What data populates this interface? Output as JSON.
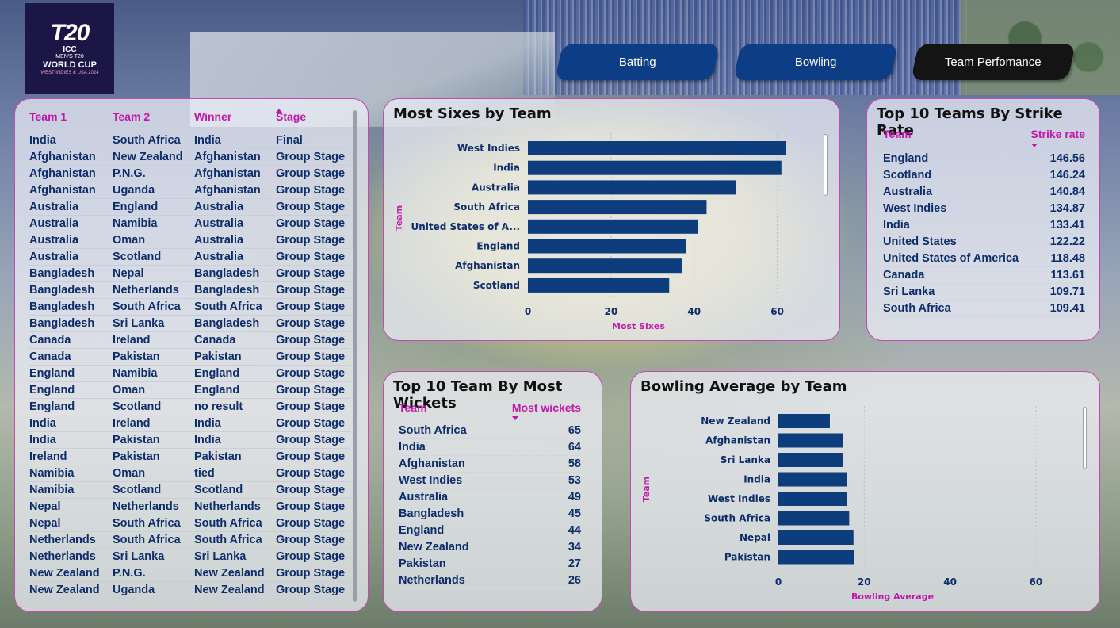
{
  "logo": {
    "mark_text": "T20",
    "line1": "ICC",
    "line2": "MEN'S T20",
    "line3": "WORLD CUP",
    "line4": "WEST INDIES & USA 2024"
  },
  "nav": {
    "batting": "Batting",
    "bowling": "Bowling",
    "team_performance": "Team Perfomance"
  },
  "matches": {
    "headers": [
      "Team 1",
      "Team 2",
      "Winner",
      "Stage"
    ],
    "rows": [
      [
        "India",
        "South Africa",
        "India",
        "Final"
      ],
      [
        "Afghanistan",
        "New Zealand",
        "Afghanistan",
        "Group Stage"
      ],
      [
        "Afghanistan",
        "P.N.G.",
        "Afghanistan",
        "Group Stage"
      ],
      [
        "Afghanistan",
        "Uganda",
        "Afghanistan",
        "Group Stage"
      ],
      [
        "Australia",
        "England",
        "Australia",
        "Group Stage"
      ],
      [
        "Australia",
        "Namibia",
        "Australia",
        "Group Stage"
      ],
      [
        "Australia",
        "Oman",
        "Australia",
        "Group Stage"
      ],
      [
        "Australia",
        "Scotland",
        "Australia",
        "Group Stage"
      ],
      [
        "Bangladesh",
        "Nepal",
        "Bangladesh",
        "Group Stage"
      ],
      [
        "Bangladesh",
        "Netherlands",
        "Bangladesh",
        "Group Stage"
      ],
      [
        "Bangladesh",
        "South Africa",
        "South Africa",
        "Group Stage"
      ],
      [
        "Bangladesh",
        "Sri Lanka",
        "Bangladesh",
        "Group Stage"
      ],
      [
        "Canada",
        "Ireland",
        "Canada",
        "Group Stage"
      ],
      [
        "Canada",
        "Pakistan",
        "Pakistan",
        "Group Stage"
      ],
      [
        "England",
        "Namibia",
        "England",
        "Group Stage"
      ],
      [
        "England",
        "Oman",
        "England",
        "Group Stage"
      ],
      [
        "England",
        "Scotland",
        "no result",
        "Group Stage"
      ],
      [
        "India",
        "Ireland",
        "India",
        "Group Stage"
      ],
      [
        "India",
        "Pakistan",
        "India",
        "Group Stage"
      ],
      [
        "Ireland",
        "Pakistan",
        "Pakistan",
        "Group Stage"
      ],
      [
        "Namibia",
        "Oman",
        "tied",
        "Group Stage"
      ],
      [
        "Namibia",
        "Scotland",
        "Scotland",
        "Group Stage"
      ],
      [
        "Nepal",
        "Netherlands",
        "Netherlands",
        "Group Stage"
      ],
      [
        "Nepal",
        "South Africa",
        "South Africa",
        "Group Stage"
      ],
      [
        "Netherlands",
        "South Africa",
        "South Africa",
        "Group Stage"
      ],
      [
        "Netherlands",
        "Sri Lanka",
        "Sri Lanka",
        "Group Stage"
      ],
      [
        "New Zealand",
        "P.N.G.",
        "New Zealand",
        "Group Stage"
      ],
      [
        "New Zealand",
        "Uganda",
        "New Zealand",
        "Group Stage"
      ]
    ]
  },
  "sixes_chart": {
    "panel_title": "Most Sixes by Team",
    "chart_data": {
      "type": "bar",
      "orientation": "horizontal",
      "title": "Most Sixes by Team",
      "xlabel": "Most Sixes",
      "ylabel": "Team",
      "categories": [
        "West Indies",
        "India",
        "Australia",
        "South Africa",
        "United States of A...",
        "England",
        "Afghanistan",
        "Scotland"
      ],
      "values": [
        62,
        61,
        50,
        43,
        41,
        38,
        37,
        34
      ],
      "xlim": [
        0,
        70
      ],
      "xticks": [
        0,
        20,
        40,
        60
      ]
    }
  },
  "strike_rate": {
    "title": "Top 10 Teams By Strike Rate",
    "col_team": "Team",
    "col_value": "Strike rate",
    "rows": [
      [
        "England",
        "146.56"
      ],
      [
        "Scotland",
        "146.24"
      ],
      [
        "Australia",
        "140.84"
      ],
      [
        "West Indies",
        "134.87"
      ],
      [
        "India",
        "133.41"
      ],
      [
        "United States",
        "122.22"
      ],
      [
        "United States of America",
        "118.48"
      ],
      [
        "Canada",
        "113.61"
      ],
      [
        "Sri Lanka",
        "109.71"
      ],
      [
        "South Africa",
        "109.41"
      ]
    ]
  },
  "wickets": {
    "title": "Top 10 Team By Most Wickets",
    "col_team": "Team",
    "col_value": "Most wickets",
    "rows": [
      [
        "South Africa",
        "65"
      ],
      [
        "India",
        "64"
      ],
      [
        "Afghanistan",
        "58"
      ],
      [
        "West Indies",
        "53"
      ],
      [
        "Australia",
        "49"
      ],
      [
        "Bangladesh",
        "45"
      ],
      [
        "England",
        "44"
      ],
      [
        "New Zealand",
        "34"
      ],
      [
        "Pakistan",
        "27"
      ],
      [
        "Netherlands",
        "26"
      ]
    ]
  },
  "bowling_avg_chart": {
    "panel_title": "Bowling Average by Team",
    "chart_data": {
      "type": "bar",
      "orientation": "horizontal",
      "title": "Bowling Average by Team",
      "xlabel": "Bowling Average",
      "ylabel": "Team",
      "categories": [
        "New Zealand",
        "Afghanistan",
        "Sri Lanka",
        "India",
        "West Indies",
        "South Africa",
        "Nepal",
        "Pakistan"
      ],
      "values": [
        12,
        15,
        15,
        16,
        16,
        16.5,
        17.5,
        17.7
      ],
      "xlim": [
        0,
        70
      ],
      "xticks": [
        0,
        20,
        40,
        60
      ]
    }
  },
  "colors": {
    "bar": "#0d3d7c",
    "accent": "#c218a9",
    "text": "#0d2d6b",
    "nav_active": "#141414",
    "nav": "#0d3d84"
  }
}
